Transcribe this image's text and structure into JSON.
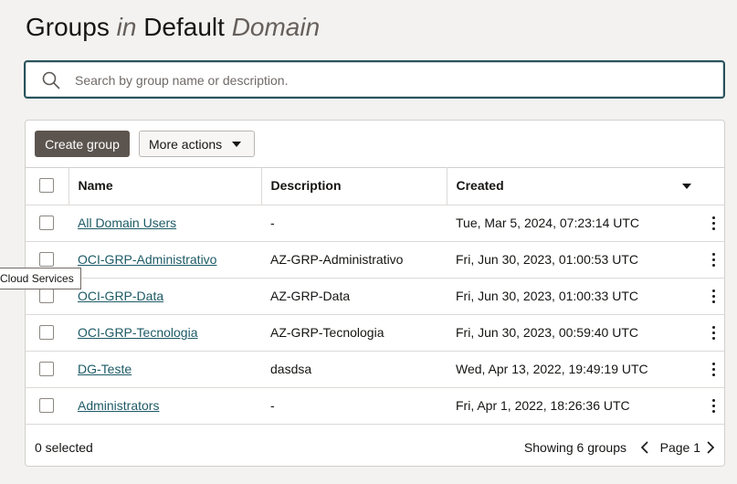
{
  "page": {
    "title_groups": "Groups",
    "title_in": "in",
    "title_default": "Default",
    "title_domain": "Domain"
  },
  "search": {
    "placeholder": "Search by group name or description."
  },
  "toolbar": {
    "create_label": "Create group",
    "more_label": "More actions"
  },
  "table": {
    "headers": {
      "name": "Name",
      "description": "Description",
      "created": "Created"
    },
    "rows": [
      {
        "name": "All Domain Users",
        "description": "-",
        "created": "Tue, Mar 5, 2024, 07:23:14 UTC"
      },
      {
        "name": "OCI-GRP-Administrativo",
        "description": "AZ-GRP-Administrativo",
        "created": "Fri, Jun 30, 2023, 01:00:53 UTC"
      },
      {
        "name": "OCI-GRP-Data",
        "description": "AZ-GRP-Data",
        "created": "Fri, Jun 30, 2023, 01:00:33 UTC"
      },
      {
        "name": "OCI-GRP-Tecnologia",
        "description": "AZ-GRP-Tecnologia",
        "created": "Fri, Jun 30, 2023, 00:59:40 UTC"
      },
      {
        "name": "DG-Teste",
        "description": "dasdsa",
        "created": "Wed, Apr 13, 2022, 19:49:19 UTC"
      },
      {
        "name": "Administrators",
        "description": "-",
        "created": "Fri, Apr 1, 2022, 18:26:36 UTC"
      }
    ]
  },
  "footer": {
    "selected": "0 selected",
    "showing": "Showing 6 groups",
    "page": "Page 1"
  },
  "tooltip": {
    "text": "Cloud Services"
  },
  "colors": {
    "accent": "#29535c",
    "link": "#1d5a66",
    "primary_button": "#5c554f",
    "background": "#f3f2f0"
  },
  "icons": {
    "search": "search-icon",
    "more_actions_caret": "chevron-down-icon",
    "sort": "sort-desc-icon",
    "row_menu": "kebab-menu-icon",
    "prev": "chevron-left-icon",
    "next": "chevron-right-icon"
  }
}
